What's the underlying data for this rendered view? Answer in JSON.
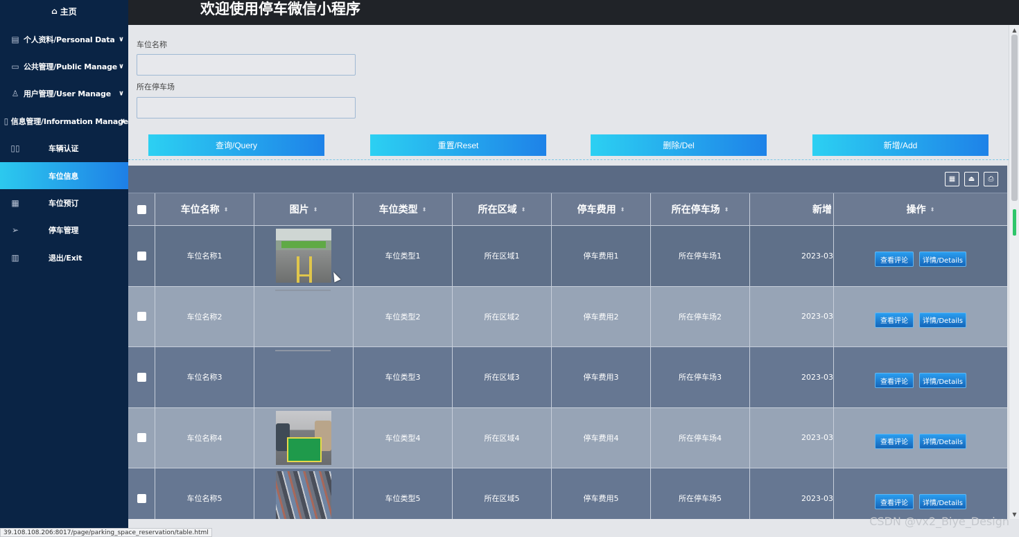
{
  "sidebar": {
    "home": {
      "icon": "home-icon",
      "label": "主页"
    },
    "items": [
      {
        "label": "个人资料/Personal Data",
        "icon": "id-card-icon",
        "expand": true
      },
      {
        "label": "公共管理/Public Manage",
        "icon": "monitor-icon",
        "expand": true
      },
      {
        "label": "用户管理/User Manage",
        "icon": "user-edit-icon",
        "expand": true
      },
      {
        "label": "信息管理/Information Manage",
        "icon": "document-icon",
        "expand": true
      },
      {
        "label": "车辆认证",
        "icon": "columns-icon"
      },
      {
        "label": "车位信息",
        "icon": "none",
        "active": true
      },
      {
        "label": "车位预订",
        "icon": "grid-icon"
      },
      {
        "label": "停车管理",
        "icon": "send-icon"
      },
      {
        "label": "退出/Exit",
        "icon": "books-icon"
      }
    ]
  },
  "topbar": {
    "title": "欢迎使用停车微信小程序"
  },
  "search": {
    "fields": [
      {
        "label": "车位名称",
        "value": ""
      },
      {
        "label": "所在停车场",
        "value": ""
      }
    ],
    "buttons": [
      "查询/Query",
      "重置/Reset",
      "删除/Del",
      "新增/Add"
    ]
  },
  "table": {
    "toolbar_icons": [
      "layout-icon",
      "export-icon",
      "print-icon"
    ],
    "headers": [
      "车位名称",
      "图片",
      "车位类型",
      "所在区域",
      "停车费用",
      "所在停车场",
      "新增",
      "操作"
    ],
    "rows": [
      {
        "name": "车位名称1",
        "type": "车位类型1",
        "area": "所在区域1",
        "fee": "停车费用1",
        "lot": "所在停车场1",
        "date": "2023-03-",
        "picture": "garage-lane"
      },
      {
        "name": "车位名称2",
        "type": "车位类型2",
        "area": "所在区域2",
        "fee": "停车费用2",
        "lot": "所在停车场2",
        "date": "2023-03-",
        "picture": ""
      },
      {
        "name": "车位名称3",
        "type": "车位类型3",
        "area": "所在区域3",
        "fee": "停车费用3",
        "lot": "所在停车场3",
        "date": "2023-03-",
        "picture": ""
      },
      {
        "name": "车位名称4",
        "type": "车位类型4",
        "area": "所在区域4",
        "fee": "停车费用4",
        "lot": "所在停车场4",
        "date": "2023-03-",
        "picture": "green-slot"
      },
      {
        "name": "车位名称5",
        "type": "车位类型5",
        "area": "所在区域5",
        "fee": "停车费用5",
        "lot": "所在停车场5",
        "date": "2023-03-",
        "picture": "aerial-lot"
      }
    ],
    "row_actions": {
      "comments": "查看评论",
      "details": "详情/Details"
    }
  },
  "status_url": "39.108.108.206:8017/page/parking_space_reservation/table.html",
  "watermark": "CSDN @vx2_Biye_Design"
}
